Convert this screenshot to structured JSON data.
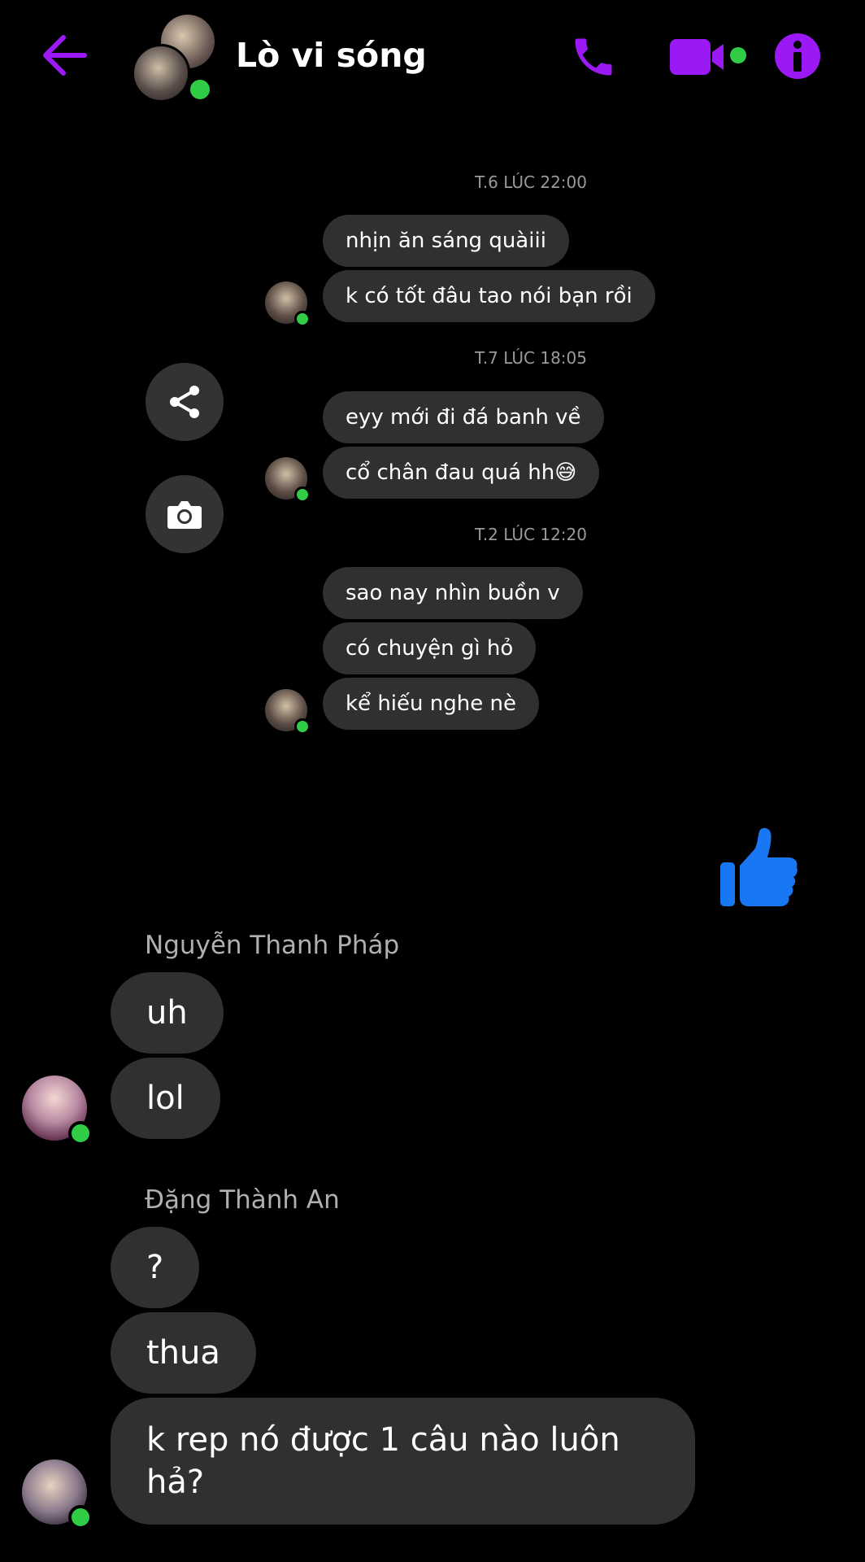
{
  "header": {
    "title": "Lò vi sóng",
    "accent_color": "#9b19f5",
    "icons": [
      "back-arrow-icon",
      "phone-icon",
      "video-camera-icon",
      "info-icon"
    ]
  },
  "thread": {
    "groups": [
      {
        "timestamp": "T.6 LÚC 22:00",
        "messages": [
          "nhịn ăn sáng quàiii",
          "k có tốt đâu tao nói bạn rồi"
        ]
      },
      {
        "timestamp": "T.7 LÚC 18:05",
        "messages": [
          "eyy mới đi đá banh về",
          "cổ chân đau quá hh😅"
        ]
      },
      {
        "timestamp": "T.2 LÚC 12:20",
        "messages": [
          "sao nay nhìn buồn v",
          "có chuyện gì hỏ",
          "kể hiếu nghe nè"
        ]
      }
    ]
  },
  "like_color": "#1877f2",
  "chat": [
    {
      "sender": "Nguyễn Thanh Pháp",
      "messages": [
        "uh",
        "lol"
      ]
    },
    {
      "sender": "Đặng Thành An",
      "messages": [
        "?",
        "thua",
        "k rep nó được 1 câu nào luôn hả?"
      ]
    }
  ]
}
